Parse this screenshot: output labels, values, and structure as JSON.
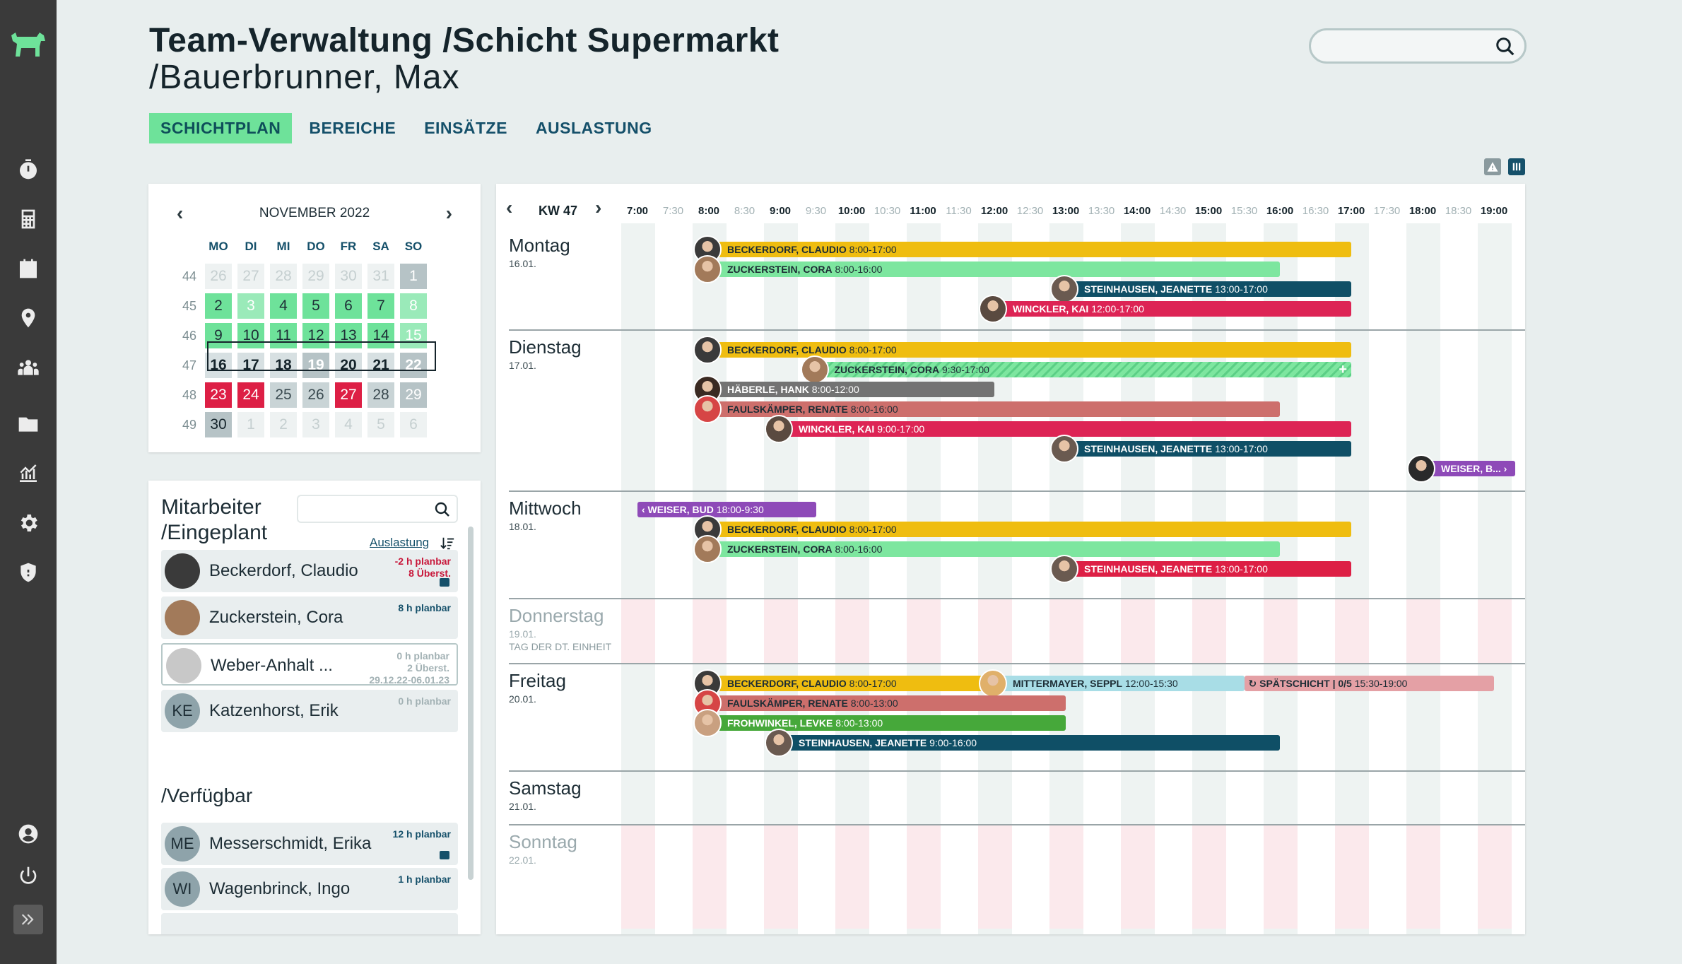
{
  "header": {
    "title_line1": "Team-Verwaltung /Schicht Supermarkt",
    "title_line2": "/Bauerbrunner, Max",
    "tabs": [
      "SCHICHTPLAN",
      "BEREICHE",
      "EINSÄTZE",
      "AUSLASTUNG"
    ]
  },
  "calendar": {
    "month": "NOVEMBER 2022",
    "weekdays": [
      "MO",
      "DI",
      "MI",
      "DO",
      "FR",
      "SA",
      "SO"
    ],
    "weeks": [
      {
        "wk": "44",
        "days": [
          "26",
          "27",
          "28",
          "29",
          "30",
          "31",
          "1"
        ],
        "styles": [
          "light",
          "light",
          "light",
          "light",
          "light",
          "light",
          "grey"
        ]
      },
      {
        "wk": "45",
        "days": [
          "2",
          "3",
          "4",
          "5",
          "6",
          "7",
          "8"
        ],
        "styles": [
          "green",
          "green2",
          "green",
          "green",
          "green",
          "green",
          "green2"
        ]
      },
      {
        "wk": "46",
        "days": [
          "9",
          "10",
          "11",
          "12",
          "13",
          "14",
          "15"
        ],
        "styles": [
          "green",
          "green",
          "green",
          "green",
          "green",
          "green",
          "green2"
        ]
      },
      {
        "wk": "47",
        "days": [
          "16",
          "17",
          "18",
          "19",
          "20",
          "21",
          "22"
        ],
        "styles": [
          "sel",
          "sel",
          "sel",
          "sel2",
          "sel",
          "sel",
          "sel2"
        ]
      },
      {
        "wk": "48",
        "days": [
          "23",
          "24",
          "25",
          "26",
          "27",
          "28",
          "29"
        ],
        "styles": [
          "red",
          "red",
          "mid",
          "mid",
          "red",
          "mid",
          "mid2"
        ]
      },
      {
        "wk": "49",
        "days": [
          "30",
          "1",
          "2",
          "3",
          "4",
          "5",
          "6"
        ],
        "styles": [
          "dark",
          "light",
          "light",
          "light",
          "light",
          "light",
          "light"
        ]
      }
    ]
  },
  "employees": {
    "title_line1": "Mitarbeiter",
    "title_line2": "/Eingeplant",
    "sort_label": "Auslastung",
    "assigned": [
      {
        "name": "Beckerdorf, Claudio",
        "initials": "",
        "info1": "-2 h planbar",
        "info2": "8 Überst.",
        "info_color": "#c8173a",
        "chat": true,
        "outlined": false,
        "avatar_color": "#3a3a3a"
      },
      {
        "name": "Zuckerstein, Cora",
        "initials": "",
        "info1": "8 h planbar",
        "info2": "",
        "info_color": "#15506a",
        "chat": false,
        "outlined": false,
        "avatar_color": "#a27a5a"
      },
      {
        "name": "Weber-Anhalt ...",
        "initials": "",
        "info1": "0 h planbar",
        "info2": "2 Überst.",
        "info3": "29.12.22-06.01.23",
        "info_color": "#a2b1b4",
        "chat": false,
        "outlined": true,
        "avatar_color": "#c8c8c8"
      },
      {
        "name": "Katzenhorst, Erik",
        "initials": "KE",
        "info1": "0 h planbar",
        "info2": "",
        "info_color": "#a2b1b4",
        "chat": false,
        "outlined": false,
        "avatar_color": "#8ea3aa"
      }
    ],
    "available_title": "/Verfügbar",
    "available": [
      {
        "name": "Messerschmidt, Erika",
        "initials": "ME",
        "info1": "12 h planbar",
        "chat": true,
        "avatar_color": "#8ea3aa"
      },
      {
        "name": "Wagenbrinck, Ingo",
        "initials": "WI",
        "info1": "1 h planbar",
        "chat": false,
        "avatar_color": "#8ea3aa"
      }
    ]
  },
  "schedule": {
    "week_label": "KW 47",
    "ticks": [
      "7:00",
      "7:30",
      "8:00",
      "8:30",
      "9:00",
      "9:30",
      "10:00",
      "10:30",
      "11:00",
      "11:30",
      "12:00",
      "12:30",
      "13:00",
      "13:30",
      "14:00",
      "14:30",
      "15:00",
      "15:30",
      "16:00",
      "16:30",
      "17:00",
      "17:30",
      "18:00",
      "18:30",
      "19:00"
    ],
    "days": [
      {
        "name": "Montag",
        "date": "16.01.",
        "holiday": "",
        "muted": false,
        "shifts": [
          {
            "name": "BECKERDORF, CLAUDIO",
            "time": "8:00-17:00",
            "start": 8.0,
            "end": 17.0,
            "color": "#efbd10",
            "text": "dark",
            "avatar": "#3a3a3a"
          },
          {
            "name": "ZUCKERSTEIN, CORA",
            "time": "8:00-16:00",
            "start": 8.0,
            "end": 16.0,
            "color": "#7de69f",
            "text": "dark",
            "avatar": "#a27a5a"
          },
          {
            "name": "STEINHAUSEN, JEANETTE",
            "time": "13:00-17:00",
            "start": 13.0,
            "end": 17.0,
            "color": "#0f4f66",
            "text": "light",
            "avatar": "#6a5a50"
          },
          {
            "name": "WINCKLER, KAI",
            "time": "12:00-17:00",
            "start": 12.0,
            "end": 17.0,
            "color": "#dd2455",
            "text": "light",
            "avatar": "#5a4a40"
          }
        ]
      },
      {
        "name": "Dienstag",
        "date": "17.01.",
        "holiday": "",
        "muted": false,
        "shifts": [
          {
            "name": "BECKERDORF, CLAUDIO",
            "time": "8:00-17:00",
            "start": 8.0,
            "end": 17.0,
            "color": "#efbd10",
            "text": "dark",
            "avatar": "#3a3a3a"
          },
          {
            "name": "ZUCKERSTEIN, CORA",
            "time": "9:30-17:00",
            "start": 9.5,
            "end": 17.0,
            "color": "#7de69f",
            "text": "dark",
            "avatar": "#a27a5a",
            "striped": true
          },
          {
            "name": "HÄBERLE, HANK",
            "time": "8:00-12:00",
            "start": 8.0,
            "end": 12.0,
            "color": "#737373",
            "text": "light",
            "avatar": "#3a2a22"
          },
          {
            "name": "FAULSKÄMPER, RENATE",
            "time": "8:00-16:00",
            "start": 8.0,
            "end": 16.0,
            "color": "#cd6f6c",
            "text": "dark",
            "avatar": "#d64545"
          },
          {
            "name": "WINCKLER, KAI",
            "time": "9:00-17:00",
            "start": 9.0,
            "end": 17.0,
            "color": "#dd2455",
            "text": "light",
            "avatar": "#5a4a40"
          },
          {
            "name": "STEINHAUSEN, JEANETTE",
            "time": "13:00-17:00",
            "start": 13.0,
            "end": 17.0,
            "color": "#0f4f66",
            "text": "light",
            "avatar": "#6a5a50"
          },
          {
            "name": "WEISER, B... ›",
            "time": "",
            "start": 18.0,
            "end": 19.3,
            "color": "#8e4ab8",
            "text": "light",
            "avatar": "#2a2a2a"
          }
        ]
      },
      {
        "name": "Mittwoch",
        "date": "18.01.",
        "holiday": "",
        "muted": false,
        "shifts": [
          {
            "name": "‹ WEISER, BUD",
            "time": "18:00-9:30",
            "start": 7.0,
            "end": 9.5,
            "color": "#8e4ab8",
            "text": "light",
            "avatar": ""
          },
          {
            "name": "BECKERDORF, CLAUDIO",
            "time": "8:00-17:00",
            "start": 8.0,
            "end": 17.0,
            "color": "#efbd10",
            "text": "dark",
            "avatar": "#3a3a3a"
          },
          {
            "name": "ZUCKERSTEIN, CORA",
            "time": "8:00-16:00",
            "start": 8.0,
            "end": 16.0,
            "color": "#7de69f",
            "text": "dark",
            "avatar": "#a27a5a"
          },
          {
            "name": "STEINHAUSEN, JEANETTE",
            "time": "13:00-17:00",
            "start": 13.0,
            "end": 17.0,
            "color": "#dd1f45",
            "text": "light",
            "avatar": "#6a5a50"
          }
        ]
      },
      {
        "name": "Donnerstag",
        "date": "19.01.",
        "holiday": "TAG DER DT. EINHEIT",
        "muted": true,
        "shifts": []
      },
      {
        "name": "Freitag",
        "date": "20.01.",
        "holiday": "",
        "muted": false,
        "shifts": [
          {
            "name": "BECKERDORF, CLAUDIO",
            "time": "8:00-17:00",
            "start": 8.0,
            "end": 12.0,
            "color": "#efbd10",
            "text": "dark",
            "avatar": "#3a3a3a"
          },
          {
            "name": "MITTERMAYER, SEPPL",
            "time": "12:00-15:30",
            "start": 12.0,
            "end": 15.5,
            "color": "#a8dde6",
            "text": "dark",
            "avatar": "#e0b06a"
          },
          {
            "name": "↻ SPÄTSCHICHT | 0/5",
            "time": "15:30-19:00",
            "start": 15.5,
            "end": 19.0,
            "color": "#e4a0a5",
            "text": "dark",
            "avatar": ""
          },
          {
            "name": "FAULSKÄMPER, RENATE",
            "time": "8:00-13:00",
            "start": 8.0,
            "end": 13.0,
            "color": "#cd6f6c",
            "text": "dark",
            "avatar": "#d64545"
          },
          {
            "name": "FROHWINKEL, LEVKE",
            "time": "8:00-13:00",
            "start": 8.0,
            "end": 13.0,
            "color": "#46a83a",
            "text": "light",
            "avatar": "#c9a080"
          },
          {
            "name": "STEINHAUSEN, JEANETTE",
            "time": "9:00-16:00",
            "start": 9.0,
            "end": 16.0,
            "color": "#0f4f66",
            "text": "light",
            "avatar": "#6a5a50"
          }
        ]
      },
      {
        "name": "Samstag",
        "date": "21.01.",
        "holiday": "",
        "muted": false,
        "shifts": []
      },
      {
        "name": "Sonntag",
        "date": "22.01.",
        "holiday": "",
        "muted": true,
        "shifts": []
      }
    ]
  },
  "colors": {
    "accent_green": "#6ee29a",
    "primary": "#15506a",
    "sidebar": "#3a3a3a"
  }
}
